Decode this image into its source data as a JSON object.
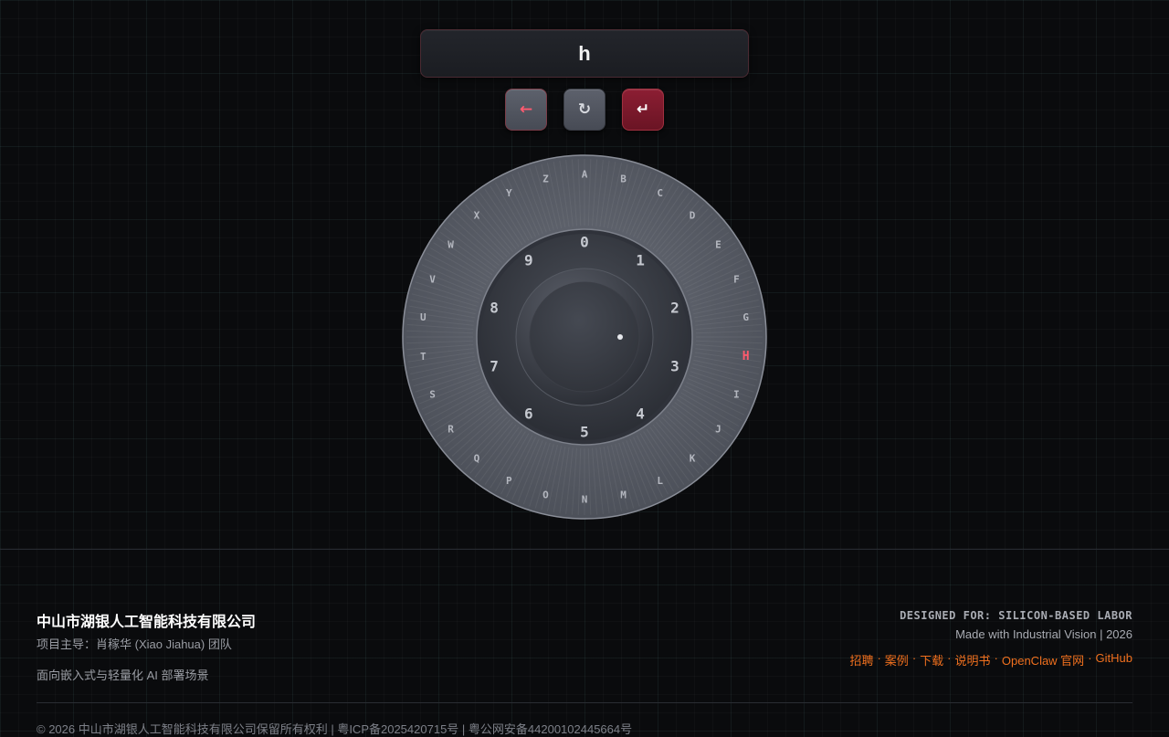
{
  "input": {
    "value": "h"
  },
  "controls": {
    "backspace_glyph": "←",
    "reset_glyph": "↻",
    "enter_glyph": "↵"
  },
  "dial": {
    "letters": [
      "A",
      "B",
      "C",
      "D",
      "E",
      "F",
      "G",
      "H",
      "I",
      "J",
      "K",
      "L",
      "M",
      "N",
      "O",
      "P",
      "Q",
      "R",
      "S",
      "T",
      "U",
      "V",
      "W",
      "X",
      "Y",
      "Z"
    ],
    "digits": [
      "0",
      "1",
      "2",
      "3",
      "4",
      "5",
      "6",
      "7",
      "8",
      "9"
    ],
    "highlighted_letter": "H",
    "highlight_color": "#ff5a6e"
  },
  "footer": {
    "company": "中山市湖银人工智能科技有限公司",
    "lead": "项目主导：肖稼华 (Xiao Jiahua) 团队",
    "tagline": "面向嵌入式与轻量化 AI 部署场景",
    "designed_for": "DESIGNED FOR: SILICON-BASED LABOR",
    "made_with": "Made with Industrial Vision | 2026",
    "links": [
      "招聘",
      "案例",
      "下载",
      "说明书",
      "OpenClaw 官网",
      "GitHub"
    ],
    "copyright": "© 2026 中山市湖银人工智能科技有限公司保留所有权利 | 粤ICP备2025420715号 | 粤公网安备44200102445664号"
  },
  "colors": {
    "accent": "#f0701e",
    "enter_button": "#8c1e33"
  }
}
